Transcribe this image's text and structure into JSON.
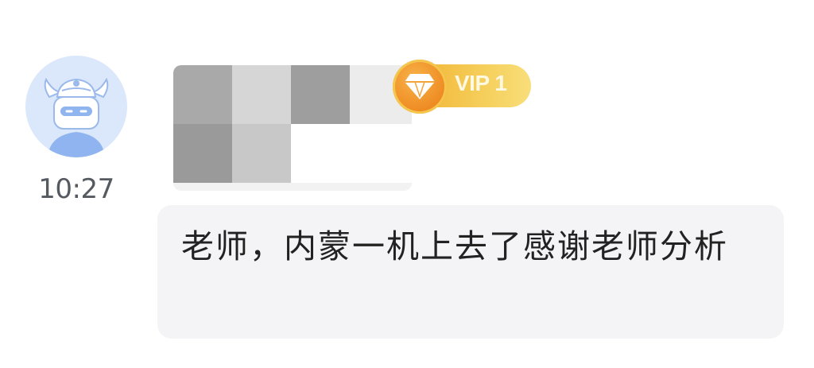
{
  "message": {
    "timestamp": "10:27",
    "sender": {
      "avatar_icon": "horned-helmet-avatar-icon",
      "badge": {
        "label": "VIP 1",
        "icon": "diamond-icon",
        "color": "#f2b435"
      }
    },
    "text": "老师，内蒙一机上去了感谢老师分析"
  }
}
